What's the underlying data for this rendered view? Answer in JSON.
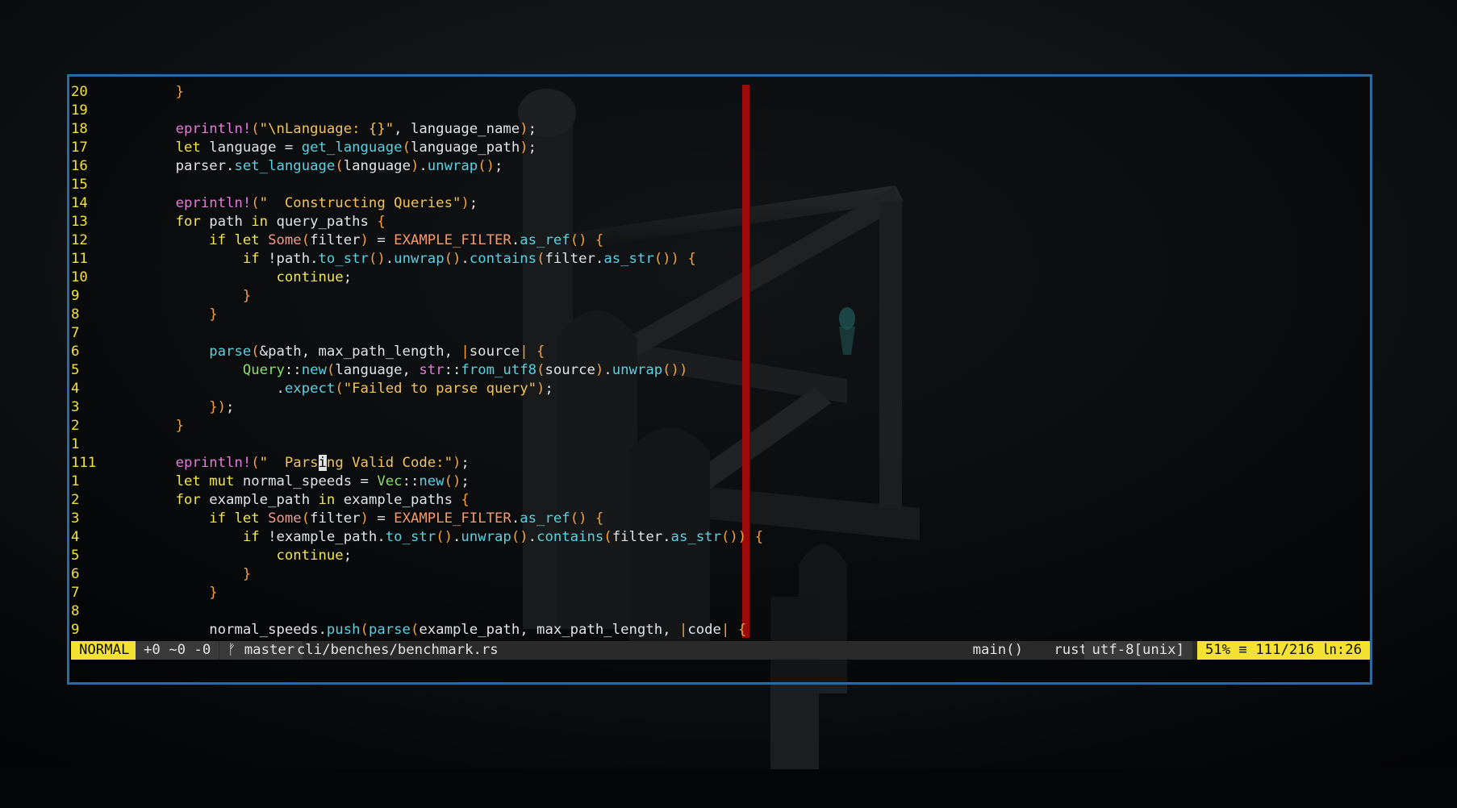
{
  "editor": {
    "lines": [
      {
        "num": "20",
        "indent": "    ",
        "tokens": [
          [
            "br",
            "}"
          ]
        ]
      },
      {
        "num": "19",
        "indent": "",
        "tokens": []
      },
      {
        "num": "18",
        "indent": "    ",
        "tokens": [
          [
            "mac",
            "eprintln!"
          ],
          [
            "br",
            "("
          ],
          [
            "str",
            "\"\\nLanguage: {}\""
          ],
          [
            "fg",
            ", language_name"
          ],
          [
            "br",
            ")"
          ],
          [
            "fg",
            ";"
          ]
        ]
      },
      {
        "num": "17",
        "indent": "    ",
        "tokens": [
          [
            "kw",
            "let"
          ],
          [
            "fg",
            " language = "
          ],
          [
            "fn",
            "get_language"
          ],
          [
            "br",
            "("
          ],
          [
            "fg",
            "language_path"
          ],
          [
            "br",
            ")"
          ],
          [
            "fg",
            ";"
          ]
        ]
      },
      {
        "num": "16",
        "indent": "    ",
        "tokens": [
          [
            "fg",
            "parser."
          ],
          [
            "fn",
            "set_language"
          ],
          [
            "br",
            "("
          ],
          [
            "fg",
            "language"
          ],
          [
            "br",
            ")"
          ],
          [
            "fg",
            "."
          ],
          [
            "fn",
            "unwrap"
          ],
          [
            "br",
            "()"
          ],
          [
            "fg",
            ";"
          ]
        ]
      },
      {
        "num": "15",
        "indent": "",
        "tokens": []
      },
      {
        "num": "14",
        "indent": "    ",
        "tokens": [
          [
            "mac",
            "eprintln!"
          ],
          [
            "br",
            "("
          ],
          [
            "str",
            "\"  Constructing Queries\""
          ],
          [
            "br",
            ")"
          ],
          [
            "fg",
            ";"
          ]
        ]
      },
      {
        "num": "13",
        "indent": "    ",
        "tokens": [
          [
            "kw",
            "for"
          ],
          [
            "fg",
            " path "
          ],
          [
            "kw",
            "in"
          ],
          [
            "fg",
            " query_paths "
          ],
          [
            "br",
            "{"
          ]
        ]
      },
      {
        "num": "12",
        "indent": "        ",
        "tokens": [
          [
            "kw",
            "if let"
          ],
          [
            "fg",
            " "
          ],
          [
            "ty",
            "Some"
          ],
          [
            "br",
            "("
          ],
          [
            "fg",
            "filter"
          ],
          [
            "br",
            ")"
          ],
          [
            "fg",
            " = "
          ],
          [
            "const",
            "EXAMPLE_FILTER"
          ],
          [
            "fg",
            "."
          ],
          [
            "fn",
            "as_ref"
          ],
          [
            "br",
            "()"
          ],
          [
            "fg",
            " "
          ],
          [
            "br",
            "{"
          ]
        ]
      },
      {
        "num": "11",
        "indent": "            ",
        "tokens": [
          [
            "kw",
            "if"
          ],
          [
            "fg",
            " !path."
          ],
          [
            "fn",
            "to_str"
          ],
          [
            "br",
            "()"
          ],
          [
            "fg",
            "."
          ],
          [
            "fn",
            "unwrap"
          ],
          [
            "br",
            "()"
          ],
          [
            "fg",
            "."
          ],
          [
            "fn",
            "contains"
          ],
          [
            "br",
            "("
          ],
          [
            "fg",
            "filter."
          ],
          [
            "fn",
            "as_str"
          ],
          [
            "br",
            "())"
          ],
          [
            "fg",
            " "
          ],
          [
            "br",
            "{"
          ]
        ]
      },
      {
        "num": "10",
        "indent": "                ",
        "tokens": [
          [
            "kw",
            "continue"
          ],
          [
            "fg",
            ";"
          ]
        ]
      },
      {
        "num": "9",
        "indent": "            ",
        "tokens": [
          [
            "br",
            "}"
          ]
        ]
      },
      {
        "num": "8",
        "indent": "        ",
        "tokens": [
          [
            "br",
            "}"
          ]
        ]
      },
      {
        "num": "7",
        "indent": "",
        "tokens": []
      },
      {
        "num": "6",
        "indent": "        ",
        "tokens": [
          [
            "fn",
            "parse"
          ],
          [
            "br",
            "("
          ],
          [
            "fg",
            "&path, max_path_length, "
          ],
          [
            "br",
            "|"
          ],
          [
            "fg",
            "source"
          ],
          [
            "br",
            "|"
          ],
          [
            "fg",
            " "
          ],
          [
            "br",
            "{"
          ]
        ]
      },
      {
        "num": "5",
        "indent": "            ",
        "tokens": [
          [
            "ty2",
            "Query"
          ],
          [
            "fg",
            "::"
          ],
          [
            "fn",
            "new"
          ],
          [
            "br",
            "("
          ],
          [
            "fg",
            "language, "
          ],
          [
            "mac",
            "str"
          ],
          [
            "fg",
            "::"
          ],
          [
            "fn",
            "from_utf8"
          ],
          [
            "br",
            "("
          ],
          [
            "fg",
            "source"
          ],
          [
            "br",
            ")"
          ],
          [
            "fg",
            "."
          ],
          [
            "fn",
            "unwrap"
          ],
          [
            "br",
            "())"
          ]
        ]
      },
      {
        "num": "4",
        "indent": "                ",
        "tokens": [
          [
            "fg",
            "."
          ],
          [
            "fn",
            "expect"
          ],
          [
            "br",
            "("
          ],
          [
            "str",
            "\"Failed to parse query\""
          ],
          [
            "br",
            ")"
          ],
          [
            "fg",
            ";"
          ]
        ]
      },
      {
        "num": "3",
        "indent": "        ",
        "tokens": [
          [
            "br",
            "})"
          ],
          [
            "fg",
            ";"
          ]
        ]
      },
      {
        "num": "2",
        "indent": "    ",
        "tokens": [
          [
            "br",
            "}"
          ]
        ]
      },
      {
        "num": "1",
        "indent": "",
        "tokens": []
      },
      {
        "num": "111",
        "indent": "    ",
        "cur": true,
        "tokens": [
          [
            "mac",
            "eprintln!"
          ],
          [
            "br",
            "("
          ],
          [
            "str",
            "\"  Pars"
          ],
          [
            "cursor",
            "i"
          ],
          [
            "str",
            "ng Valid Code:\""
          ],
          [
            "br",
            ")"
          ],
          [
            "fg",
            ";"
          ]
        ]
      },
      {
        "num": "1",
        "indent": "    ",
        "tokens": [
          [
            "kw",
            "let mut"
          ],
          [
            "fg",
            " normal_speeds = "
          ],
          [
            "ty2",
            "Vec"
          ],
          [
            "fg",
            "::"
          ],
          [
            "fn",
            "new"
          ],
          [
            "br",
            "()"
          ],
          [
            "fg",
            ";"
          ]
        ]
      },
      {
        "num": "2",
        "indent": "    ",
        "tokens": [
          [
            "kw",
            "for"
          ],
          [
            "fg",
            " example_path "
          ],
          [
            "kw",
            "in"
          ],
          [
            "fg",
            " example_paths "
          ],
          [
            "br",
            "{"
          ]
        ]
      },
      {
        "num": "3",
        "indent": "        ",
        "tokens": [
          [
            "kw",
            "if let"
          ],
          [
            "fg",
            " "
          ],
          [
            "ty",
            "Some"
          ],
          [
            "br",
            "("
          ],
          [
            "fg",
            "filter"
          ],
          [
            "br",
            ")"
          ],
          [
            "fg",
            " = "
          ],
          [
            "const",
            "EXAMPLE_FILTER"
          ],
          [
            "fg",
            "."
          ],
          [
            "fn",
            "as_ref"
          ],
          [
            "br",
            "()"
          ],
          [
            "fg",
            " "
          ],
          [
            "br",
            "{"
          ]
        ]
      },
      {
        "num": "4",
        "indent": "            ",
        "tokens": [
          [
            "kw",
            "if"
          ],
          [
            "fg",
            " !example_path."
          ],
          [
            "fn",
            "to_str"
          ],
          [
            "br",
            "()"
          ],
          [
            "fg",
            "."
          ],
          [
            "fn",
            "unwrap"
          ],
          [
            "br",
            "()"
          ],
          [
            "fg",
            "."
          ],
          [
            "fn",
            "contains"
          ],
          [
            "br",
            "("
          ],
          [
            "fg",
            "filter."
          ],
          [
            "fn",
            "as_str"
          ],
          [
            "br",
            "())"
          ],
          [
            "fg",
            " "
          ],
          [
            "br",
            "{"
          ]
        ]
      },
      {
        "num": "5",
        "indent": "                ",
        "tokens": [
          [
            "kw",
            "continue"
          ],
          [
            "fg",
            ";"
          ]
        ]
      },
      {
        "num": "6",
        "indent": "            ",
        "tokens": [
          [
            "br",
            "}"
          ]
        ]
      },
      {
        "num": "7",
        "indent": "        ",
        "tokens": [
          [
            "br",
            "}"
          ]
        ]
      },
      {
        "num": "8",
        "indent": "",
        "tokens": []
      },
      {
        "num": "9",
        "indent": "        ",
        "tokens": [
          [
            "fg",
            "normal_speeds."
          ],
          [
            "fn",
            "push"
          ],
          [
            "br",
            "("
          ],
          [
            "fn",
            "parse"
          ],
          [
            "br",
            "("
          ],
          [
            "fg",
            "example_path, max_path_length, "
          ],
          [
            "br",
            "|"
          ],
          [
            "fg",
            "code"
          ],
          [
            "br",
            "|"
          ],
          [
            "fg",
            " "
          ],
          [
            "br",
            "{"
          ]
        ]
      }
    ]
  },
  "statusline": {
    "mode": "NORMAL",
    "git_diff": "+0 ~0 -0",
    "branch": "ᚠ master",
    "file": "cli/benches/benchmark.rs",
    "function": "main()",
    "filetype": "rust",
    "encoding": "utf-8[unix]",
    "position": "51% ≡ 111/216 ㏑:26"
  },
  "colors": {
    "accent_yellow": "#f4e232",
    "border_blue": "#2d6a9f",
    "colorcolumn_red": "#9c0a0a"
  }
}
